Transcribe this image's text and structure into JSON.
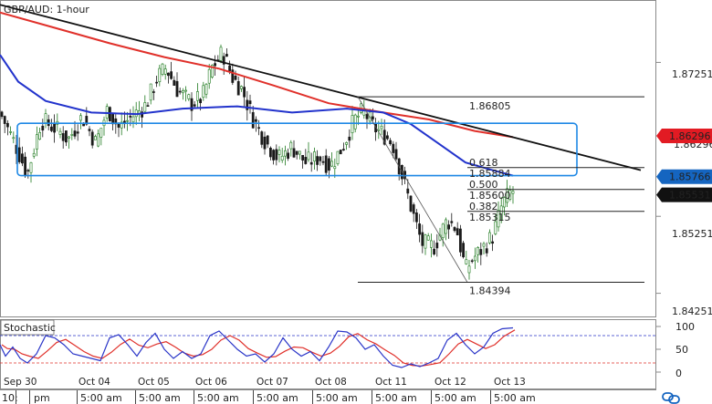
{
  "colors": {
    "up": "#1f7a1f",
    "down": "#1a1a1a",
    "ma_red": "#e0302a",
    "ma_blue": "#2233cc",
    "trendline": "#111111",
    "zone": "#1e88e5",
    "tag_red": "#e21b23",
    "tag_blue": "#1565c0",
    "tag_black": "#111111",
    "stoch_k": "#2a35c8",
    "stoch_d": "#e0302a"
  },
  "chart_data": [
    {
      "type": "candlestick",
      "title": "GBP/AUD: 1-hour",
      "ylim": [
        1.8395,
        1.8805
      ],
      "y_ticks": [
        "1.87251",
        "1.85251",
        "1.84251"
      ],
      "x_ticks": [
        "Sep 30",
        "Oct 04",
        "Oct 05",
        "Oct 06",
        "Oct 07",
        "Oct 08",
        "Oct 11",
        "Oct 12",
        "Oct 13"
      ],
      "time_labels": [
        "10:",
        "pm",
        "5:00 am",
        "5:00 am",
        "5:00 am",
        "5:00 am",
        "5:00 am",
        "5:00 am",
        "5:00 am",
        "5:00 am"
      ],
      "ohlc_path": [
        [
          0,
          1.866
        ],
        [
          8,
          1.864
        ],
        [
          18,
          1.8615
        ],
        [
          30,
          1.858
        ],
        [
          45,
          1.865
        ],
        [
          60,
          1.864
        ],
        [
          75,
          1.8625
        ],
        [
          90,
          1.8655
        ],
        [
          105,
          1.862
        ],
        [
          118,
          1.8665
        ],
        [
          130,
          1.864
        ],
        [
          145,
          1.8655
        ],
        [
          160,
          1.867
        ],
        [
          172,
          1.8705
        ],
        [
          182,
          1.8718
        ],
        [
          195,
          1.8688
        ],
        [
          210,
          1.8672
        ],
        [
          222,
          1.868
        ],
        [
          232,
          1.8718
        ],
        [
          244,
          1.8738
        ],
        [
          255,
          1.8705
        ],
        [
          265,
          1.869
        ],
        [
          278,
          1.865
        ],
        [
          292,
          1.862
        ],
        [
          305,
          1.86
        ],
        [
          320,
          1.8615
        ],
        [
          335,
          1.8595
        ],
        [
          350,
          1.8602
        ],
        [
          362,
          1.859
        ],
        [
          375,
          1.8615
        ],
        [
          388,
          1.865
        ],
        [
          398,
          1.8662
        ],
        [
          410,
          1.864
        ],
        [
          420,
          1.8632
        ],
        [
          430,
          1.862
        ],
        [
          440,
          1.858
        ],
        [
          452,
          1.853
        ],
        [
          462,
          1.849
        ],
        [
          475,
          1.8485
        ],
        [
          490,
          1.852
        ],
        [
          500,
          1.851
        ],
        [
          510,
          1.8455
        ],
        [
          518,
          1.847
        ],
        [
          530,
          1.8485
        ],
        [
          540,
          1.85
        ],
        [
          550,
          1.854
        ],
        [
          560,
          1.8558
        ]
      ],
      "ma_red": [
        [
          0,
          1.879
        ],
        [
          60,
          1.877
        ],
        [
          120,
          1.875
        ],
        [
          180,
          1.8732
        ],
        [
          240,
          1.8717
        ],
        [
          300,
          1.8695
        ],
        [
          360,
          1.8672
        ],
        [
          420,
          1.866
        ],
        [
          470,
          1.8651
        ],
        [
          520,
          1.8636
        ],
        [
          562,
          1.8628
        ]
      ],
      "ma_blue": [
        [
          0,
          1.8735
        ],
        [
          20,
          1.87
        ],
        [
          50,
          1.8675
        ],
        [
          100,
          1.866
        ],
        [
          150,
          1.8658
        ],
        [
          200,
          1.8665
        ],
        [
          260,
          1.8668
        ],
        [
          320,
          1.866
        ],
        [
          380,
          1.8665
        ],
        [
          420,
          1.866
        ],
        [
          450,
          1.8645
        ],
        [
          480,
          1.862
        ],
        [
          510,
          1.8595
        ],
        [
          540,
          1.8585
        ],
        [
          562,
          1.8578
        ]
      ],
      "trendline": [
        [
          0,
          1.88
        ],
        [
          702,
          1.8585
        ]
      ],
      "zone": {
        "y_top": 1.8646,
        "y_bottom": 1.8578
      },
      "fib_swing": {
        "high": 1.86805,
        "low": 1.84394
      },
      "fib_levels": [
        {
          "ratio": "0.618",
          "price": "1.85884",
          "value": 1.85884
        },
        {
          "ratio": "0.500",
          "price": "1.85600",
          "value": 1.856
        },
        {
          "ratio": "0.382",
          "price": "1.85315",
          "value": 1.85315
        }
      ],
      "fib_top_label": "1.86805",
      "fib_bottom_label": "1.84394",
      "fib_bottom_value": 1.84394,
      "fib_top_value": 1.86805,
      "price_tags": [
        {
          "text": "1.86296",
          "value": 1.86296,
          "color": "#e21b23"
        },
        {
          "text": "1.85766",
          "value": 1.85766,
          "color": "#1565c0"
        },
        {
          "text": "1.85531",
          "value": 1.85531,
          "color": "#111111"
        }
      ],
      "ghost_tag": "1.86296"
    },
    {
      "type": "line",
      "title": "Stochastic",
      "ylim": [
        0,
        100
      ],
      "y_ticks": [
        "100",
        "50",
        "0"
      ],
      "overbought": 80,
      "oversold": 20,
      "k_anchors": [
        [
          0,
          60
        ],
        [
          6,
          35
        ],
        [
          14,
          55
        ],
        [
          22,
          30
        ],
        [
          30,
          20
        ],
        [
          40,
          40
        ],
        [
          50,
          80
        ],
        [
          60,
          75
        ],
        [
          70,
          60
        ],
        [
          80,
          40
        ],
        [
          90,
          35
        ],
        [
          100,
          30
        ],
        [
          110,
          25
        ],
        [
          120,
          75
        ],
        [
          130,
          82
        ],
        [
          140,
          60
        ],
        [
          150,
          35
        ],
        [
          160,
          65
        ],
        [
          170,
          85
        ],
        [
          180,
          50
        ],
        [
          190,
          30
        ],
        [
          200,
          45
        ],
        [
          210,
          30
        ],
        [
          220,
          40
        ],
        [
          230,
          80
        ],
        [
          240,
          90
        ],
        [
          250,
          70
        ],
        [
          260,
          50
        ],
        [
          270,
          35
        ],
        [
          280,
          40
        ],
        [
          290,
          22
        ],
        [
          300,
          40
        ],
        [
          310,
          75
        ],
        [
          320,
          50
        ],
        [
          330,
          35
        ],
        [
          340,
          45
        ],
        [
          350,
          25
        ],
        [
          360,
          55
        ],
        [
          370,
          90
        ],
        [
          380,
          88
        ],
        [
          390,
          75
        ],
        [
          400,
          50
        ],
        [
          410,
          60
        ],
        [
          420,
          35
        ],
        [
          430,
          15
        ],
        [
          440,
          10
        ],
        [
          450,
          18
        ],
        [
          460,
          12
        ],
        [
          470,
          20
        ],
        [
          480,
          30
        ],
        [
          490,
          70
        ],
        [
          500,
          85
        ],
        [
          510,
          60
        ],
        [
          520,
          40
        ],
        [
          530,
          55
        ],
        [
          540,
          85
        ],
        [
          550,
          95
        ],
        [
          562,
          97
        ]
      ]
    }
  ]
}
